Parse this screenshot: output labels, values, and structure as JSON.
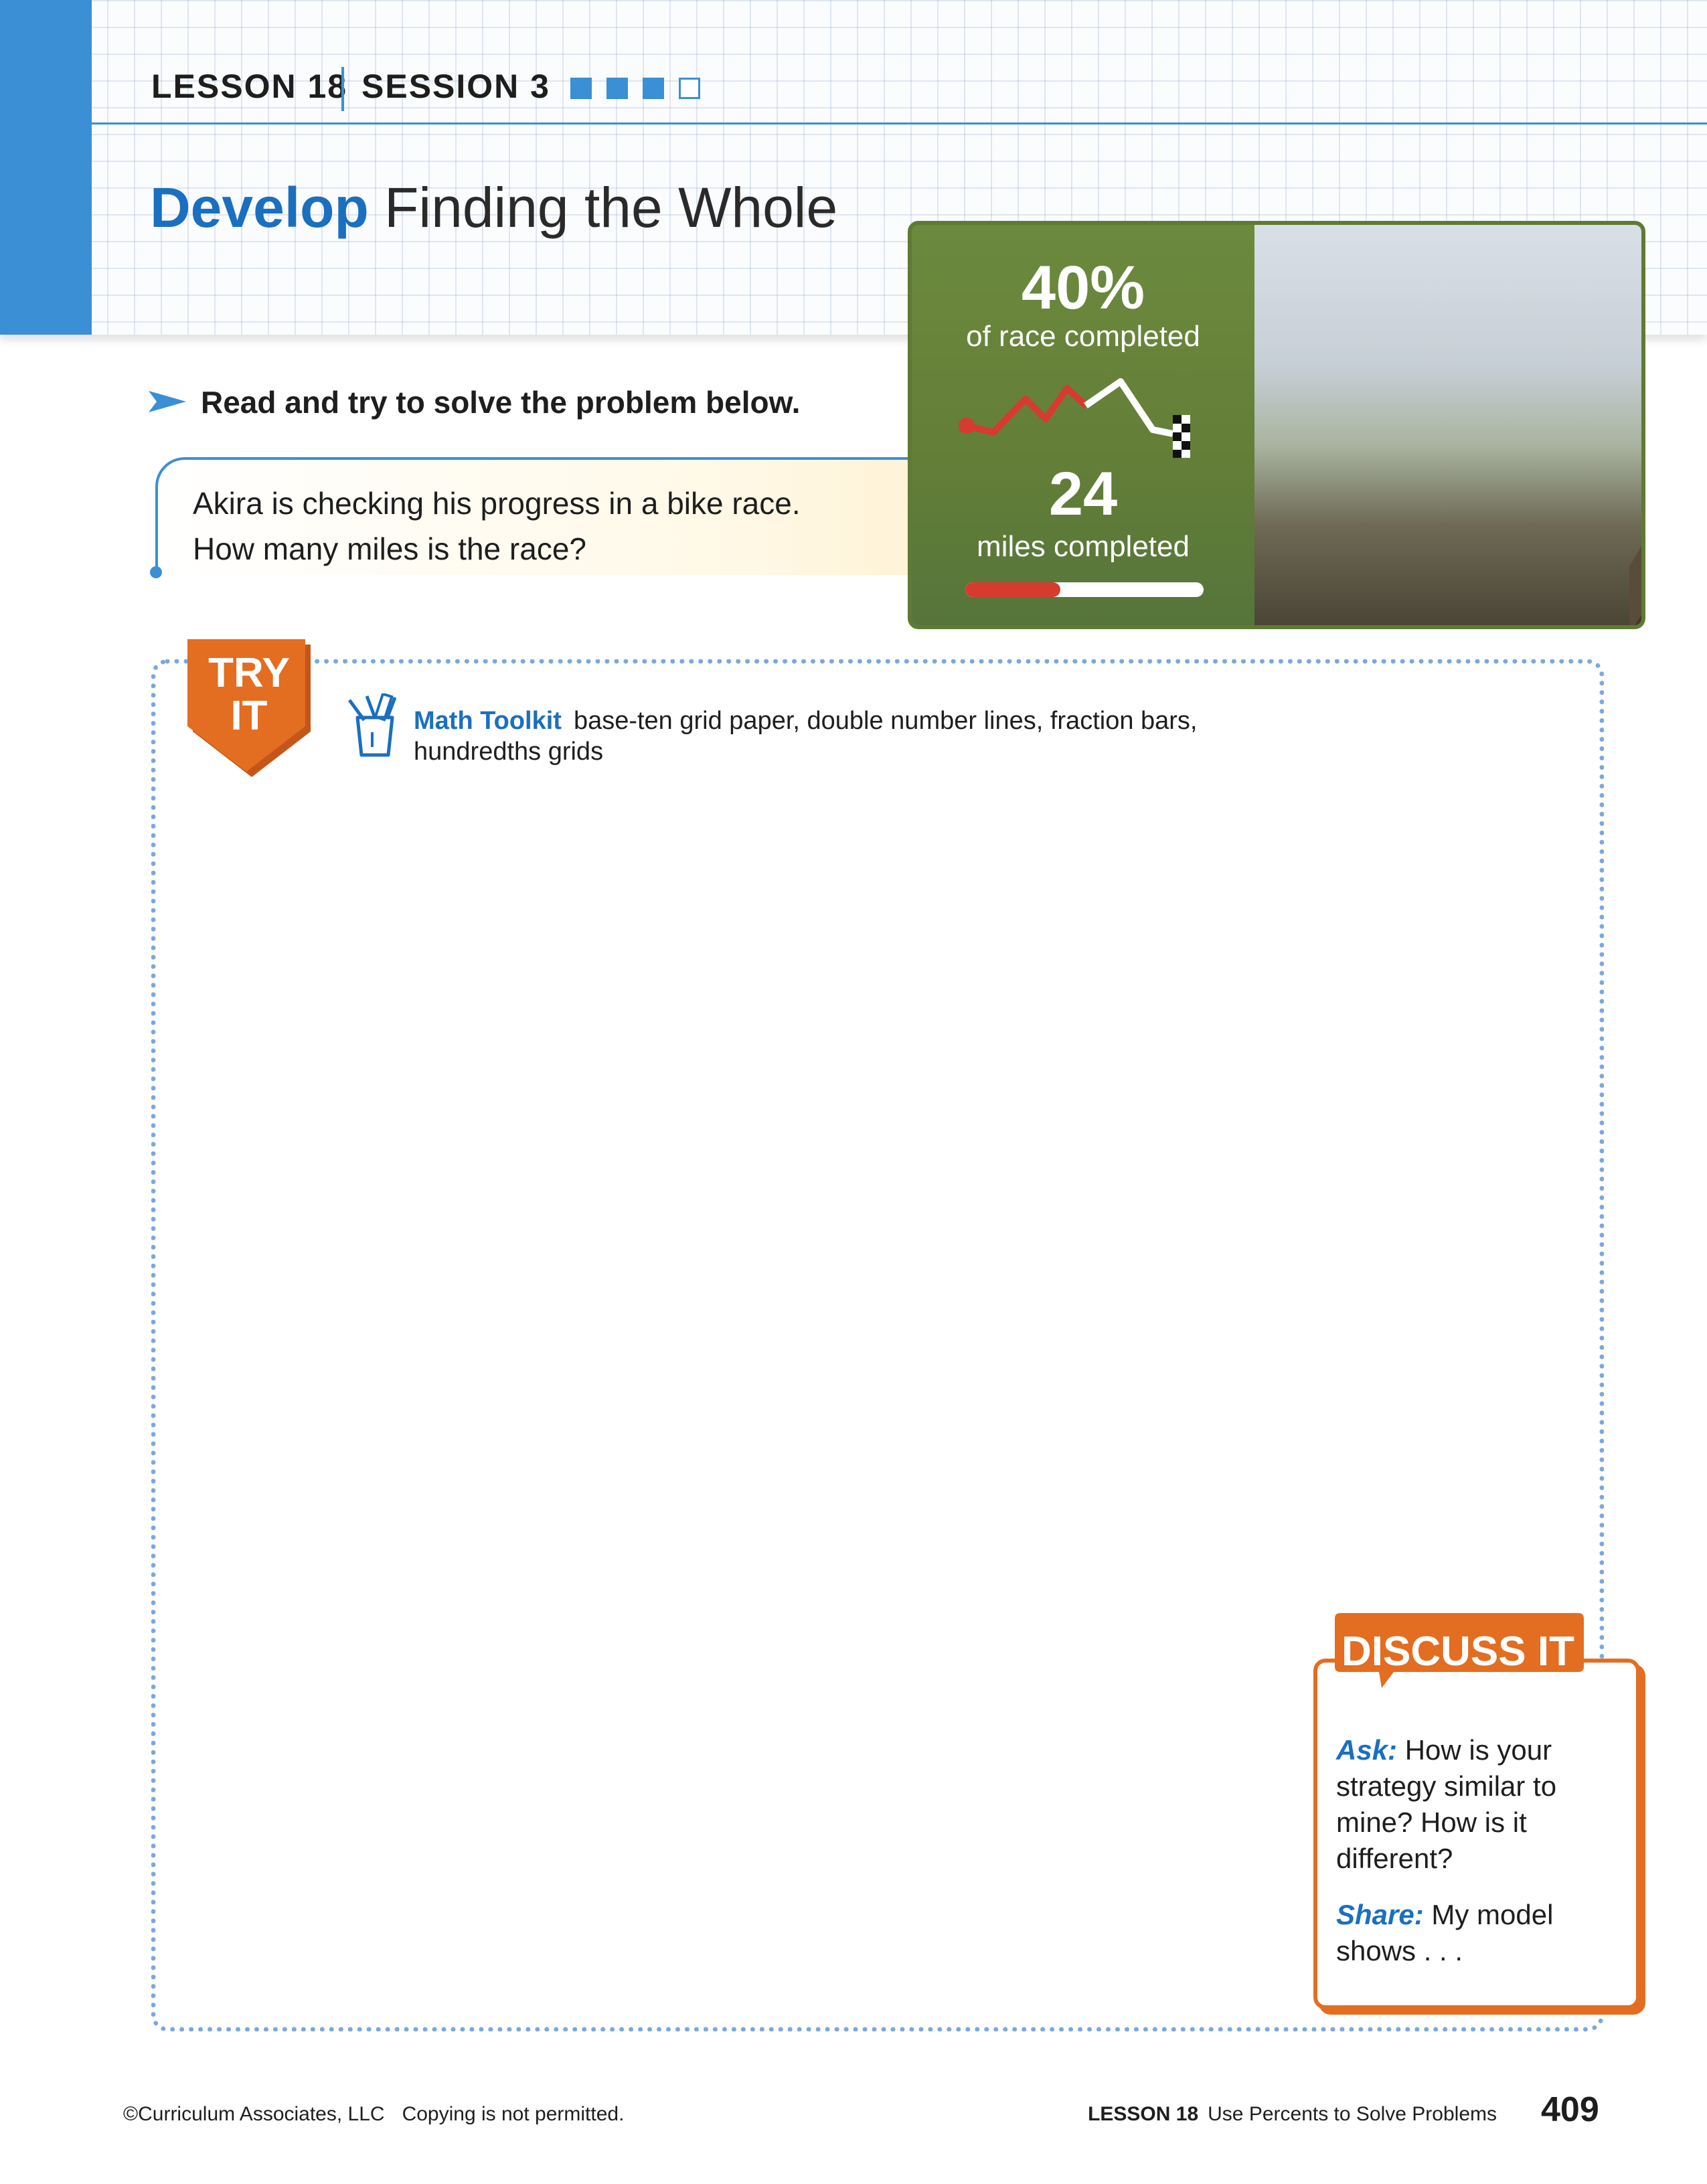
{
  "header": {
    "lesson": "LESSON 18",
    "session": "SESSION 3",
    "session_progress": {
      "completed": 3,
      "total": 4
    },
    "title_strong": "Develop",
    "title_rest": "Finding the Whole"
  },
  "instruction": "Read and try to solve the problem below.",
  "problem": {
    "line1": "Akira is checking his progress in a bike race.",
    "line2": "How many miles is the race?"
  },
  "race_graphic": {
    "percent": "40%",
    "percent_label": "of race completed",
    "miles": "24",
    "miles_label": "miles completed",
    "progress_fraction": 0.4,
    "colors": {
      "panel": "#647f38",
      "route_done": "#d63b2f",
      "route_todo": "#ffffff"
    }
  },
  "try_it": {
    "badge_line1": "TRY",
    "badge_line2": "IT",
    "toolkit_label": "Math Toolkit",
    "toolkit_items": "base-ten grid paper, double number lines, fraction bars,",
    "toolkit_items_2": "hundredths grids",
    "icon": "pencil-cup-icon"
  },
  "discuss_it": {
    "label": "DISCUSS IT",
    "ask_label": "Ask:",
    "ask_text": "How is your strategy similar to mine? How is it different?",
    "share_label": "Share:",
    "share_text": "My model shows . . ."
  },
  "footer": {
    "copyright": "©Curriculum Associates, LLC",
    "notice": "Copying is not permitted.",
    "lesson": "LESSON 18",
    "lesson_title": "Use Percents to Solve Problems",
    "page_number": "409"
  },
  "colors": {
    "accent_blue": "#3b8fd4",
    "title_blue": "#1b6fbf",
    "orange": "#e36d20",
    "dotted_border": "#7aa8de"
  }
}
